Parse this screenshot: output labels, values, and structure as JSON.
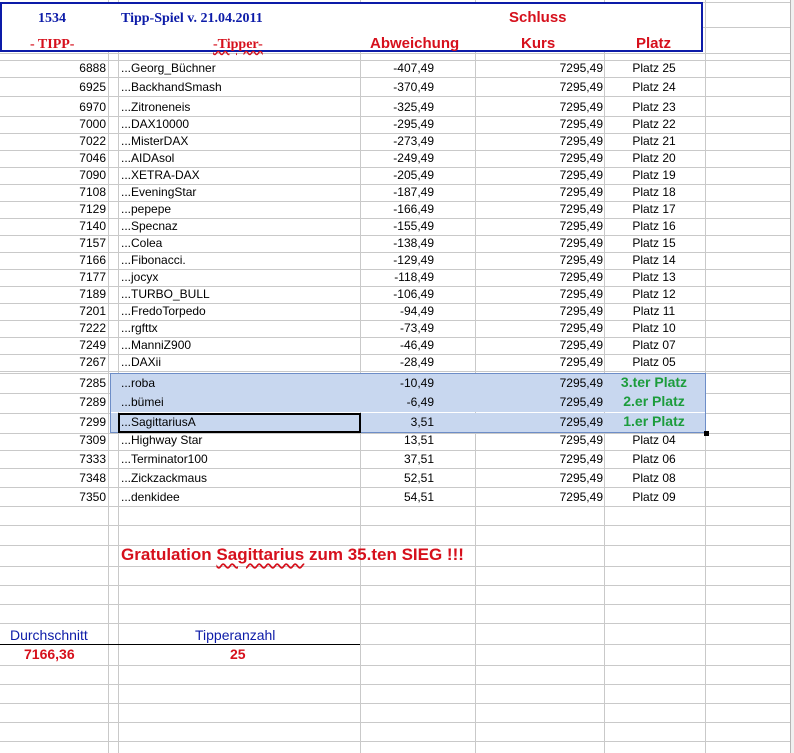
{
  "header": {
    "id": "1534",
    "title": "Tipp-Spiel v. 21.04.2011",
    "schluss": "Schluss",
    "col_tipp": "- TIPP-",
    "col_tipper": "-Tipper-",
    "col_abweichung": "Abweichung",
    "col_kurs": "Kurs",
    "col_platz": "Platz"
  },
  "rows": [
    {
      "tipp": "6888",
      "tipper": "...Georg_Büchner",
      "abweichung": "-407,49",
      "kurs": "7295,49",
      "platz": "Platz 25"
    },
    {
      "tipp": "6925",
      "tipper": "...BackhandSmash",
      "abweichung": "-370,49",
      "kurs": "7295,49",
      "platz": "Platz 24"
    },
    {
      "tipp": "6970",
      "tipper": "...Zitroneneis",
      "abweichung": "-325,49",
      "kurs": "7295,49",
      "platz": "Platz 23"
    },
    {
      "tipp": "7000",
      "tipper": "...DAX10000",
      "abweichung": "-295,49",
      "kurs": "7295,49",
      "platz": "Platz 22"
    },
    {
      "tipp": "7022",
      "tipper": "...MisterDAX",
      "abweichung": "-273,49",
      "kurs": "7295,49",
      "platz": "Platz 21"
    },
    {
      "tipp": "7046",
      "tipper": "...AIDAsol",
      "abweichung": "-249,49",
      "kurs": "7295,49",
      "platz": "Platz 20"
    },
    {
      "tipp": "7090",
      "tipper": "...XETRA-DAX",
      "abweichung": "-205,49",
      "kurs": "7295,49",
      "platz": "Platz 19"
    },
    {
      "tipp": "7108",
      "tipper": "...EveningStar",
      "abweichung": "-187,49",
      "kurs": "7295,49",
      "platz": "Platz 18"
    },
    {
      "tipp": "7129",
      "tipper": "...pepepe",
      "abweichung": "-166,49",
      "kurs": "7295,49",
      "platz": "Platz 17"
    },
    {
      "tipp": "7140",
      "tipper": "...Specnaz",
      "abweichung": "-155,49",
      "kurs": "7295,49",
      "platz": "Platz 16"
    },
    {
      "tipp": "7157",
      "tipper": "...Colea",
      "abweichung": "-138,49",
      "kurs": "7295,49",
      "platz": "Platz 15"
    },
    {
      "tipp": "7166",
      "tipper": "...Fibonacci.",
      "abweichung": "-129,49",
      "kurs": "7295,49",
      "platz": "Platz 14"
    },
    {
      "tipp": "7177",
      "tipper": "...jocyx",
      "abweichung": "-118,49",
      "kurs": "7295,49",
      "platz": "Platz 13"
    },
    {
      "tipp": "7189",
      "tipper": "...TURBO_BULL",
      "abweichung": "-106,49",
      "kurs": "7295,49",
      "platz": "Platz 12"
    },
    {
      "tipp": "7201",
      "tipper": "...FredoTorpedo",
      "abweichung": "-94,49",
      "kurs": "7295,49",
      "platz": "Platz 11"
    },
    {
      "tipp": "7222",
      "tipper": "...rgfttx",
      "abweichung": "-73,49",
      "kurs": "7295,49",
      "platz": "Platz 10"
    },
    {
      "tipp": "7249",
      "tipper": "...ManniZ900",
      "abweichung": "-46,49",
      "kurs": "7295,49",
      "platz": "Platz 07"
    },
    {
      "tipp": "7267",
      "tipper": "...DAXii",
      "abweichung": "-28,49",
      "kurs": "7295,49",
      "platz": "Platz 05"
    },
    {
      "tipp": "7285",
      "tipper": "...roba",
      "abweichung": "-10,49",
      "kurs": "7295,49",
      "platz": "3.ter Platz"
    },
    {
      "tipp": "7289",
      "tipper": "...bümei",
      "abweichung": "-6,49",
      "kurs": "7295,49",
      "platz": "2.er Platz"
    },
    {
      "tipp": "7299",
      "tipper": "...SagittariusA",
      "abweichung": "3,51",
      "kurs": "7295,49",
      "platz": "1.er Platz"
    },
    {
      "tipp": "7309",
      "tipper": "...Highway Star",
      "abweichung": "13,51",
      "kurs": "7295,49",
      "platz": "Platz 04"
    },
    {
      "tipp": "7333",
      "tipper": "...Terminator100",
      "abweichung": "37,51",
      "kurs": "7295,49",
      "platz": "Platz 06"
    },
    {
      "tipp": "7348",
      "tipper": "...Zickzackmaus",
      "abweichung": "52,51",
      "kurs": "7295,49",
      "platz": "Platz 08"
    },
    {
      "tipp": "7350",
      "tipper": "...denkidee",
      "abweichung": "54,51",
      "kurs": "7295,49",
      "platz": "Platz 09"
    }
  ],
  "gratulation": {
    "prefix": "Gratulation ",
    "name": "Sagittarius",
    "suffix": " zum 35.ten SIEG !!!"
  },
  "stats": {
    "durchschnitt_label": "Durchschnitt",
    "durchschnitt_value": "7166,36",
    "tipperanzahl_label": "Tipperanzahl",
    "tipperanzahl_value": "25"
  },
  "colors": {
    "header_blue": "#0c1ba8",
    "accent_red": "#d6101c",
    "winner_green": "#1c9c3c",
    "highlight_fill": "#c8d7ef"
  }
}
